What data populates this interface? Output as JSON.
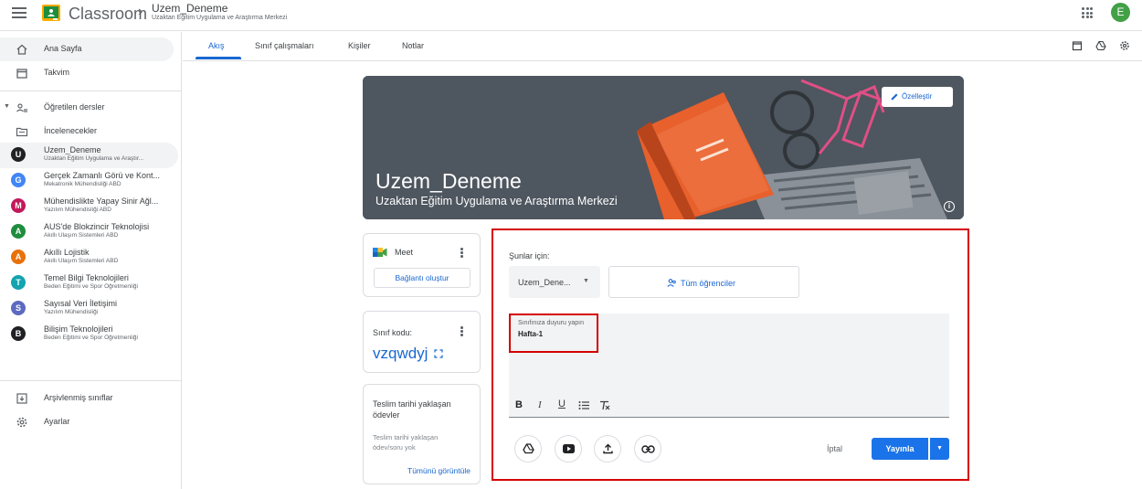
{
  "header": {
    "app_title": "Classroom",
    "course_name": "Uzem_Deneme",
    "course_subtitle": "Uzaktan Eğitim Uygulama ve Araştırma Merkezi",
    "account_initial": "E"
  },
  "sidebar": {
    "home": "Ana Sayfa",
    "calendar": "Takvim",
    "teaching": "Öğretilen dersler",
    "to_review": "İncelenecekler",
    "classes": [
      {
        "initial": "U",
        "name": "Uzem_Deneme",
        "sub": "Uzaktan Eğitim Uygulama ve Araştır...",
        "color": "#202124"
      },
      {
        "initial": "G",
        "name": "Gerçek Zamanlı Görü ve Kont...",
        "sub": "Mekatronik Mühendisliği ABD",
        "color": "#4285f4"
      },
      {
        "initial": "M",
        "name": "Mühendislikte Yapay Sinir Ağl...",
        "sub": "Yazılım Mühendisliği ABD",
        "color": "#c2185b"
      },
      {
        "initial": "A",
        "name": "AUS'de Blokzincir Teknolojisi",
        "sub": "Akıllı Ulaşım Sistemleri ABD",
        "color": "#1e8e3e"
      },
      {
        "initial": "A",
        "name": "Akıllı Lojistik",
        "sub": "Akıllı Ulaşım Sistemleri ABD",
        "color": "#e8710a"
      },
      {
        "initial": "T",
        "name": "Temel Bilgi Teknolojileri",
        "sub": "Beden Eğitimi ve Spor Öğretmenliği",
        "color": "#12a4af"
      },
      {
        "initial": "S",
        "name": "Sayısal Veri İletişimi",
        "sub": "Yazılım Mühendisliği",
        "color": "#5c6bc0"
      },
      {
        "initial": "B",
        "name": "Bilişim Teknolojileri",
        "sub": "Beden Eğitimi ve Spor Öğretmenliği",
        "color": "#202124"
      }
    ],
    "archived": "Arşivlenmiş sınıflar",
    "settings": "Ayarlar"
  },
  "tabs": [
    "Akış",
    "Sınıf çalışmaları",
    "Kişiler",
    "Notlar"
  ],
  "banner": {
    "title": "Uzem_Deneme",
    "subtitle": "Uzaktan Eğitim Uygulama ve Araştırma Merkezi",
    "customize": "Özelleştir"
  },
  "meet": {
    "label": "Meet",
    "create_link": "Bağlantı oluştur"
  },
  "class_code": {
    "label": "Sınıf kodu:",
    "code": "vzqwdyj"
  },
  "upcoming": {
    "title": "Teslim tarihi yaklaşan ödevler",
    "empty": "Teslim tarihi yaklaşan ödev/soru yok",
    "view_all": "Tümünü görüntüle"
  },
  "composer": {
    "for_label": "Şunlar için:",
    "class_select": "Uzem_Dene...",
    "students": "Tüm öğrenciler",
    "field_label": "Sınıfınıza duyuru yapın",
    "field_value": "Hafta-1",
    "cancel": "İptal",
    "publish": "Yayınla"
  },
  "colors": {
    "accent": "#1967d2",
    "publish_button": "#1a73e8",
    "highlight_frame": "#d50000"
  }
}
